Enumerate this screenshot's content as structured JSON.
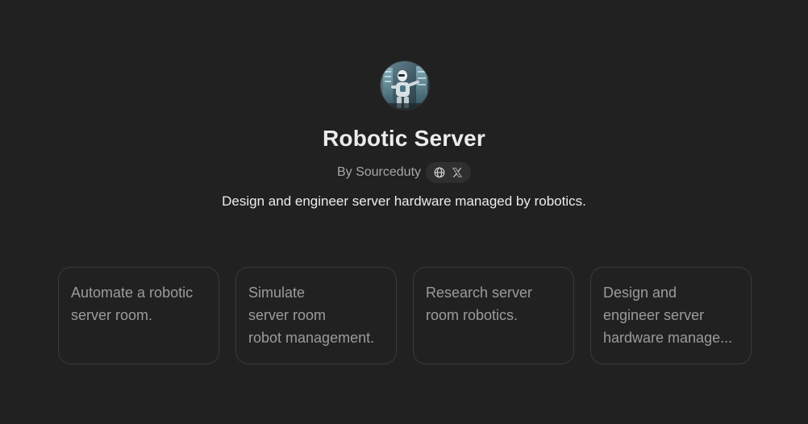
{
  "gpt": {
    "title": "Robotic Server",
    "author_prefix": "By",
    "author_name": "Sourceduty",
    "byline": "By Sourceduty",
    "description": "Design and engineer server hardware managed by robotics."
  },
  "icons": {
    "website": "globe-icon",
    "social": "x-logo-icon"
  },
  "prompt_cards": [
    {
      "lines": [
        "Automate a robotic",
        "server room."
      ]
    },
    {
      "lines": [
        "Simulate",
        "server room",
        "robot management."
      ]
    },
    {
      "lines": [
        "Research server",
        "room robotics."
      ]
    },
    {
      "lines": [
        "Design and",
        "engineer server",
        "hardware manage..."
      ]
    }
  ],
  "colors": {
    "background": "#212121",
    "card_border": "#3a3a3a",
    "title_text": "#ececec",
    "muted_text": "#a6a6a6",
    "card_text": "#9b9b9b",
    "pill_background": "#2f2f2f"
  }
}
